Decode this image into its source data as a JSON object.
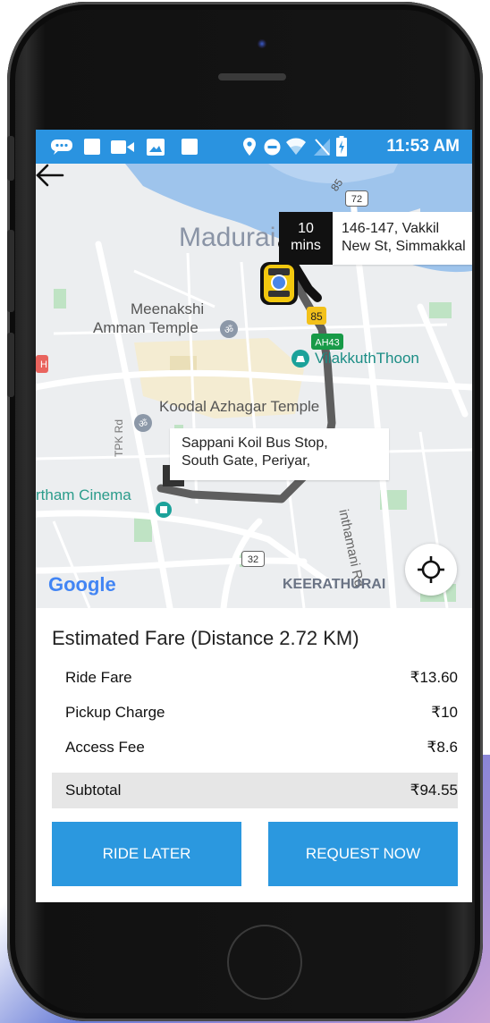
{
  "statusbar": {
    "time": "11:53 AM",
    "icons": [
      "chat-icon",
      "square-icon",
      "video-icon",
      "image-icon",
      "square-icon",
      "location-icon",
      "dnd-icon",
      "wifi-icon",
      "no-sim-icon",
      "battery-charging-icon"
    ]
  },
  "map": {
    "eta_number": "10",
    "eta_unit": "mins",
    "pickup_line1": "146-147, Vakkil",
    "pickup_line2": "New St, Simmakkal",
    "drop_line1": "Sappani Koil Bus Stop,",
    "drop_line2": "South Gate, Periyar,",
    "labels": {
      "city": "Madurai",
      "temple_line1": "Meenakshi",
      "temple_line2": "Amman Temple",
      "vilakkuthoon": "VilakkuthThoon",
      "koodal": "Koodal Azhagar Temple",
      "tpk": "TPK Rd",
      "cinema": "rtham Cinema",
      "keerathurai": "KEERATHURAI",
      "road_right": "inthamani Rd",
      "shield_85_a": "85",
      "shield_85_b": "85",
      "shield_72": "72",
      "shield_32": "32",
      "shield_ah43": "AH43",
      "google": "Google"
    }
  },
  "fare": {
    "title": "Estimated Fare (Distance 2.72 KM)",
    "rows": [
      {
        "label": "Ride Fare",
        "value": "₹13.60"
      },
      {
        "label": "Pickup Charge",
        "value": "₹10"
      },
      {
        "label": "Access Fee",
        "value": "₹8.6"
      }
    ],
    "subtotal": {
      "label": "Subtotal",
      "value": "₹94.55"
    }
  },
  "buttons": {
    "ride_later": "RIDE LATER",
    "request_now": "REQUEST NOW"
  },
  "colors": {
    "primary": "#2b98df",
    "statusbar": "#2a93e0",
    "taxi": "#f2c80f"
  }
}
